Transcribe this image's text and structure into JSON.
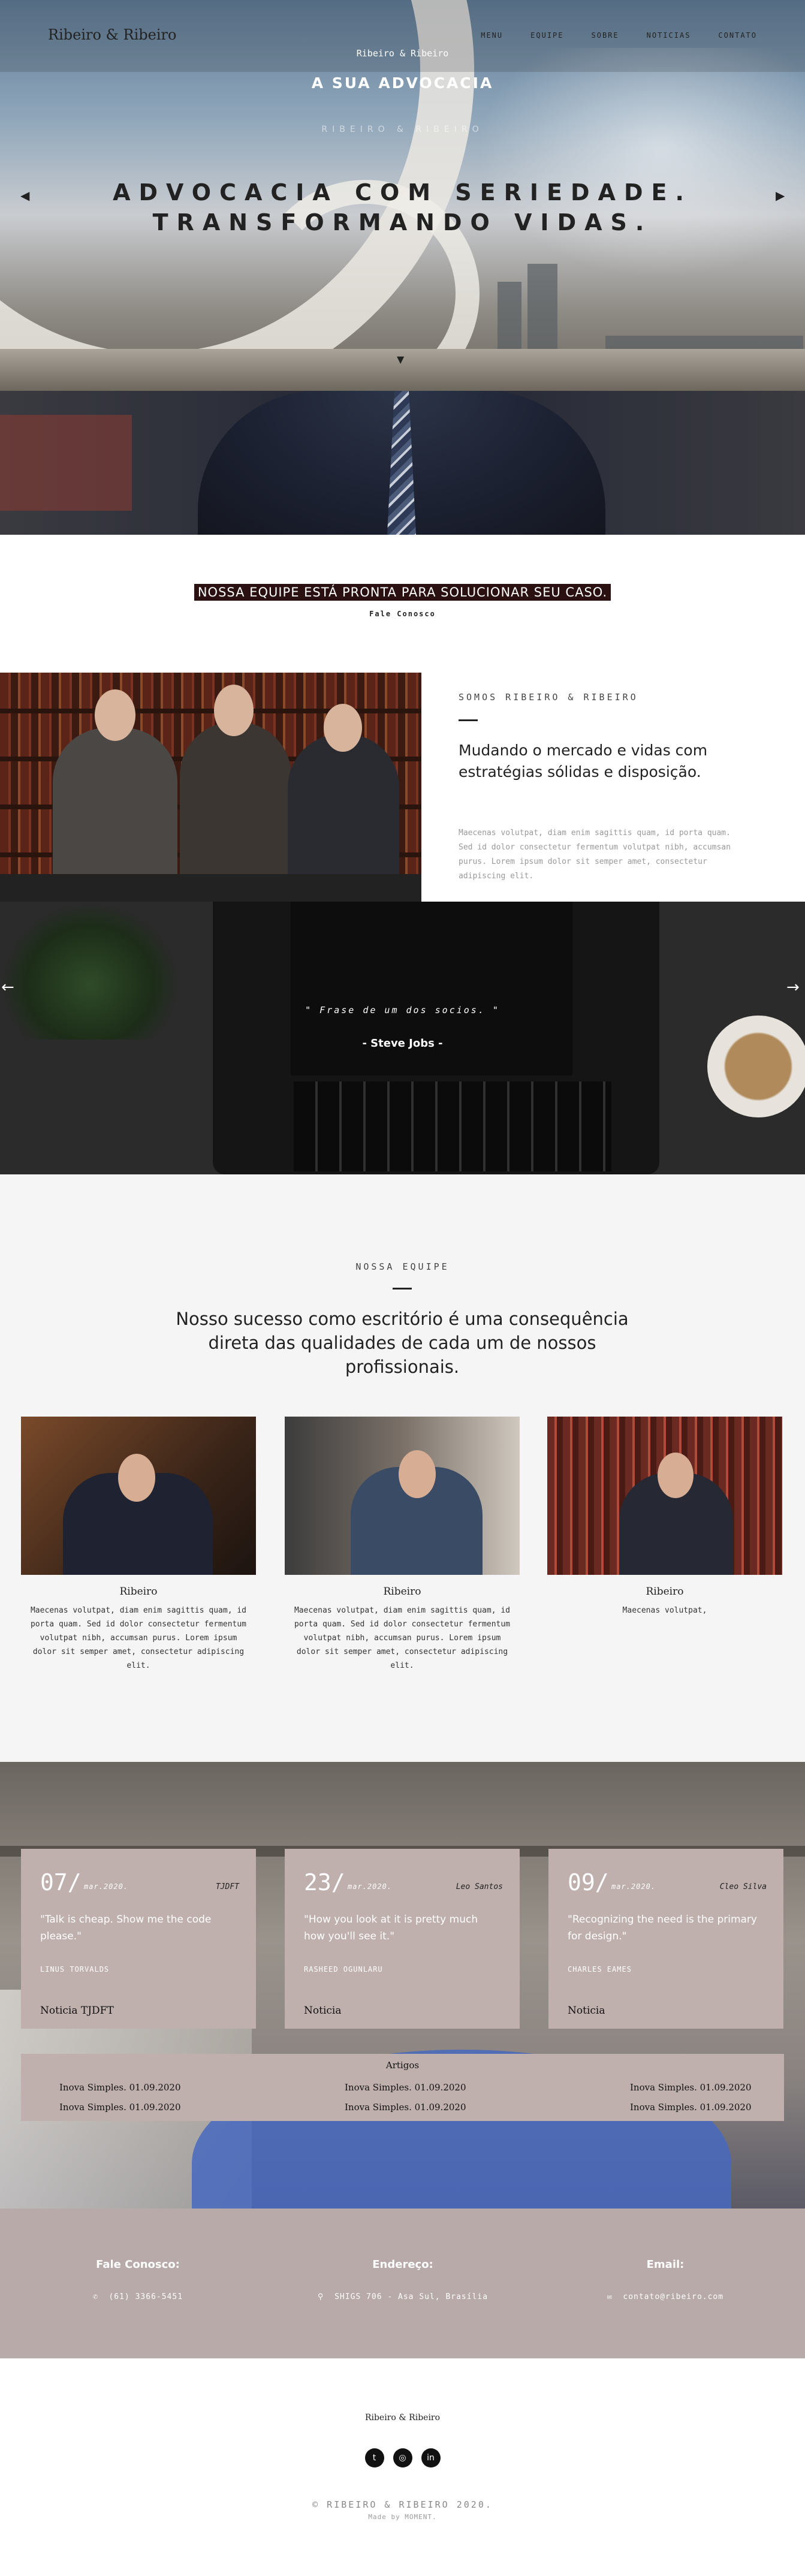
{
  "header": {
    "brand": "Ribeiro & Ribeiro",
    "nav": [
      "MENU",
      "EQUIPE",
      "SOBRE",
      "NOTICIAS",
      "CONTATO"
    ]
  },
  "hero": {
    "subtitle": "RIBEIRO & RIBEIRO",
    "title_line1": "ADVOCACIA COM SERIEDADE.",
    "title_line2": "TRANSFORMANDO VIDAS."
  },
  "promo": {
    "small": "Ribeiro & Ribeiro",
    "big": "A SUA ADVOCACIA"
  },
  "cta": {
    "title": "NOSSA EQUIPE ESTÁ PRONTA PARA SOLUCIONAR SEU CASO.",
    "link": "Fale Conosco"
  },
  "about": {
    "kicker": "SOMOS RIBEIRO & RIBEIRO",
    "title": "Mudando o mercado e vidas com estratégias sólidas e disposição.",
    "body": "Maecenas volutpat, diam enim sagittis quam, id porta quam. Sed id dolor consectetur fermentum volutpat nibh, accumsan purus. Lorem ipsum dolor sit semper amet, consectetur adipiscing elit."
  },
  "quote": {
    "text": "\" Frase de um dos socios. \"",
    "author": "- Steve Jobs -"
  },
  "team": {
    "kicker": "NOSSA EQUIPE",
    "title": "Nosso sucesso como escritório é uma consequência direta das qualidades de cada um de nossos profissionais.",
    "members": [
      {
        "name": "Ribeiro",
        "desc": "Maecenas volutpat, diam enim sagittis quam, id porta quam. Sed id dolor consectetur fermentum volutpat nibh, accumsan purus. Lorem ipsum dolor sit semper amet, consectetur adipiscing elit."
      },
      {
        "name": "Ribeiro",
        "desc": "Maecenas volutpat, diam enim sagittis quam, id porta quam. Sed id dolor consectetur fermentum volutpat nibh, accumsan purus. Lorem ipsum dolor sit semper amet, consectetur adipiscing elit."
      },
      {
        "name": "Ribeiro",
        "desc": "Maecenas volutpat,"
      }
    ]
  },
  "news": {
    "cards": [
      {
        "day": "07/",
        "month": "mar.2020.",
        "author": "TJDFT",
        "quote": "\"Talk is cheap. Show me the code please.\"",
        "who": "LINUS TORVALDS",
        "tag": "Noticia TJDFT"
      },
      {
        "day": "23/",
        "month": "mar.2020.",
        "author": "Leo Santos",
        "quote": "\"How you look at it is pretty much how you'll see it.\"",
        "who": "RASHEED OGUNLARU",
        "tag": "Noticia"
      },
      {
        "day": "09/",
        "month": "mar.2020.",
        "author": "Cleo Silva",
        "quote": "\"Recognizing the need is the primary for design.\"",
        "who": "CHARLES EAMES",
        "tag": "Noticia"
      }
    ],
    "articles_title": "Artigos",
    "articles": [
      [
        "Inova Simples. 01.09.2020",
        "Inova Simples. 01.09.2020"
      ],
      [
        "Inova Simples. 01.09.2020",
        "Inova Simples. 01.09.2020"
      ],
      [
        "Inova Simples. 01.09.2020",
        "Inova Simples. 01.09.2020"
      ]
    ]
  },
  "contact": {
    "phone_h": "Fale Conosco:",
    "phone_v": "(61) 3366-5451",
    "addr_h": "Endereço:",
    "addr_v": "SHIGS 706 - Asa Sul, Brasília",
    "email_h": "Email:",
    "email_v": "contato@ribeiro.com"
  },
  "footer": {
    "brand": "Ribeiro & Ribeiro",
    "social": [
      "twitter-icon",
      "instagram-icon",
      "linkedin-icon"
    ],
    "copy": "© RIBEIRO & RIBEIRO 2020.",
    "made": "Made by MOMENT."
  },
  "colors": {
    "card_bg": "#bfb0ae",
    "contact_bg": "#b8aaa9",
    "cta_highlight": "#2a1010"
  }
}
